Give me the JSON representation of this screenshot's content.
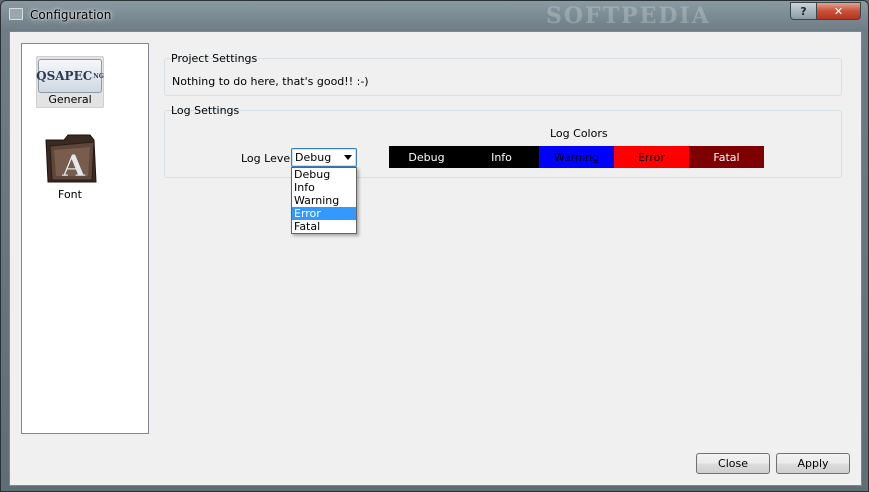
{
  "window": {
    "title": "Configuration",
    "watermark": "SOFTPEDIA",
    "help_label": "?",
    "close_label": "✕"
  },
  "sidebar": {
    "items": [
      {
        "label": "General",
        "icon": "qsapecng-logo-icon",
        "logo_text": "QSAPEC",
        "logo_sup": "NG",
        "selected": true
      },
      {
        "label": "Font",
        "icon": "font-folder-icon",
        "selected": false
      }
    ]
  },
  "project_settings": {
    "title": "Project Settings",
    "message": "Nothing to do here, that's good!! :-)"
  },
  "log_settings": {
    "title": "Log Settings",
    "level_label": "Log Level:",
    "level_value": "Debug",
    "options": [
      {
        "label": "Debug",
        "highlighted": false
      },
      {
        "label": "Info",
        "highlighted": false
      },
      {
        "label": "Warning",
        "highlighted": false
      },
      {
        "label": "Error",
        "highlighted": true
      },
      {
        "label": "Fatal",
        "highlighted": false
      }
    ],
    "colors_label": "Log Colors",
    "colors": [
      {
        "label": "Debug",
        "bg": "#000000",
        "fg": "#ffffff"
      },
      {
        "label": "Info",
        "bg": "#000000",
        "fg": "#ffffff"
      },
      {
        "label": "Warning",
        "bg": "#0000ff",
        "fg": "#000000"
      },
      {
        "label": "Error",
        "bg": "#ff0000",
        "fg": "#000000"
      },
      {
        "label": "Fatal",
        "bg": "#7f0000",
        "fg": "#ffffff"
      }
    ]
  },
  "buttons": {
    "close": "Close",
    "apply": "Apply"
  }
}
